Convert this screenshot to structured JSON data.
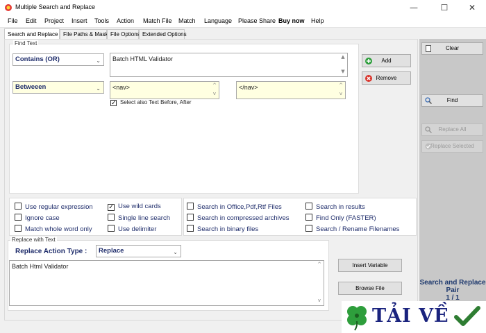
{
  "window": {
    "title": "Multiple Search and Replace",
    "controls": {
      "minimize": "—",
      "maximize": "☐",
      "close": "✕"
    }
  },
  "menu": [
    "File",
    "Edit",
    "Project",
    "Insert",
    "Tools",
    "Action",
    "Match File",
    "Match",
    "Language",
    "Please Share",
    "Buy now",
    "Help"
  ],
  "tabs": [
    "Search and Replace",
    "File Paths & Masks",
    "File Options",
    "Extended Options"
  ],
  "find": {
    "group_title": "Find Text",
    "mode": "Contains (OR)",
    "text": "Batch HTML Validator",
    "between_mode": "Betweeen",
    "before_text": "<nav>",
    "after_text": "</nav>",
    "select_also_label": "Select also Text Before, After",
    "add_label": "Add",
    "remove_label": "Remove"
  },
  "options_left": [
    {
      "label": "Use regular expression",
      "checked": false
    },
    {
      "label": "Ignore case",
      "checked": false
    },
    {
      "label": "Match whole word only",
      "checked": false
    }
  ],
  "options_mid": [
    {
      "label": "Use wild cards",
      "checked": true
    },
    {
      "label": "Single line search",
      "checked": false
    },
    {
      "label": "Use delimiter",
      "checked": false
    }
  ],
  "options_files": [
    {
      "label": "Search in Office,Pdf,Rtf Files",
      "checked": false
    },
    {
      "label": "Search in compressed archives",
      "checked": false
    },
    {
      "label": "Search in binary files",
      "checked": false
    }
  ],
  "options_results": [
    {
      "label": "Search in results",
      "checked": false
    },
    {
      "label": "Find Only (FASTER)",
      "checked": false
    },
    {
      "label": "Search / Rename Filenames",
      "checked": false
    }
  ],
  "replace": {
    "group_title": "Replace with Text",
    "action_label": "Replace Action Type :",
    "action_value": "Replace",
    "text": "Batch Html Validator",
    "insert_variable_label": "Insert Variable",
    "browse_file_label": "Browse File"
  },
  "side": {
    "clear_label": "Clear",
    "find_label": "Find",
    "replace_all_label": "Replace All",
    "replace_selected_label": "Replace Selected",
    "pair_title": "Search and Replace Pair",
    "pair_count": "1 / 1"
  },
  "watermark": {
    "text": "TẢI VỀ",
    "check_icon": "checkmark-icon",
    "clover_icon": "clover-icon",
    "text_color": "#1a237e",
    "accent_color": "#2e7d32"
  },
  "colors": {
    "label_blue": "#1f2d6b",
    "highlight_yellow": "#ffffe1",
    "side_panel": "#c8c8c8"
  }
}
